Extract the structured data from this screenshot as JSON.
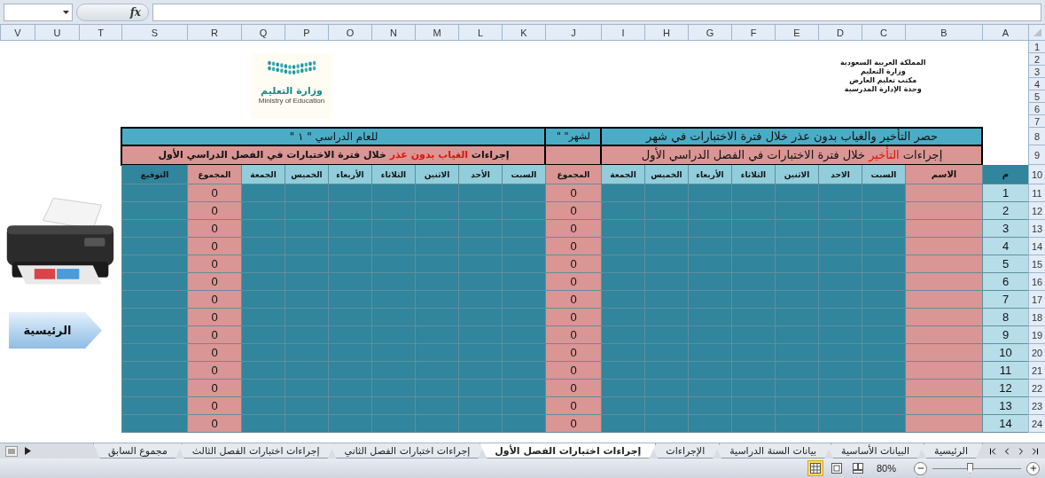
{
  "formula_bar": {
    "function_label": "fx"
  },
  "column_headers": [
    "A",
    "B",
    "C",
    "D",
    "E",
    "F",
    "G",
    "H",
    "I",
    "J",
    "K",
    "L",
    "M",
    "N",
    "O",
    "P",
    "Q",
    "R",
    "S",
    "T",
    "U",
    "V"
  ],
  "row_numbers": [
    "1",
    "2",
    "3",
    "4",
    "5",
    "6",
    "7",
    "8",
    "9",
    "10",
    "11",
    "12",
    "13",
    "14",
    "15",
    "16",
    "17",
    "18",
    "19",
    "20",
    "21",
    "22",
    "23",
    "24"
  ],
  "letterhead": [
    "المملكة العربية السعودية",
    "وزارة التعليم",
    "مكتب تعليم العارض",
    "وحدة الإدارة المدرسية"
  ],
  "logo": {
    "name_ar": "وزارة التعليم",
    "name_en": "Ministry of Education"
  },
  "title_row": {
    "summary": "حصر التأخير والغياب بدون عذر خلال فترة الاختبارات في شهر",
    "month": "لشهر\" \"",
    "year": "للعام الدراسي \" ١ \""
  },
  "section_row": {
    "lateness": [
      {
        "text": "إجراءات ",
        "highlight": false
      },
      {
        "text": "التأخير",
        "highlight": true
      },
      {
        "text": " خلال فترة الاختبارات في الفصل الدراسي الأول",
        "highlight": false
      }
    ],
    "absence": [
      {
        "text": "إجراءات ",
        "highlight": false
      },
      {
        "text": "الغياب بدون عذر",
        "highlight": true
      },
      {
        "text": " خلال فترة الاختبارات في الفصل الدراسي الأول",
        "highlight": false
      }
    ]
  },
  "table_header": {
    "index": "م",
    "name": "الاسم",
    "lateness_days": [
      "السبت",
      "الاحد",
      "الاثنين",
      "الثلاثاء",
      "الأربعاء",
      "الخميس",
      "الجمعة"
    ],
    "lateness_total": "المجموع",
    "absence_days": [
      "السبت",
      "الأحد",
      "الاثنين",
      "الثلاثاء",
      "الأربعاء",
      "الخميس",
      "الجمعة"
    ],
    "absence_total": "المجموع",
    "signature": "التوقيع"
  },
  "students": [
    {
      "index": "1",
      "lateness_total": "0",
      "absence_total": "0"
    },
    {
      "index": "2",
      "lateness_total": "0",
      "absence_total": "0"
    },
    {
      "index": "3",
      "lateness_total": "0",
      "absence_total": "0"
    },
    {
      "index": "4",
      "lateness_total": "0",
      "absence_total": "0"
    },
    {
      "index": "5",
      "lateness_total": "0",
      "absence_total": "0"
    },
    {
      "index": "6",
      "lateness_total": "0",
      "absence_total": "0"
    },
    {
      "index": "7",
      "lateness_total": "0",
      "absence_total": "0"
    },
    {
      "index": "8",
      "lateness_total": "0",
      "absence_total": "0"
    },
    {
      "index": "9",
      "lateness_total": "0",
      "absence_total": "0"
    },
    {
      "index": "10",
      "lateness_total": "0",
      "absence_total": "0"
    },
    {
      "index": "11",
      "lateness_total": "0",
      "absence_total": "0"
    },
    {
      "index": "12",
      "lateness_total": "0",
      "absence_total": "0"
    },
    {
      "index": "13",
      "lateness_total": "0",
      "absence_total": "0"
    },
    {
      "index": "14",
      "lateness_total": "0",
      "absence_total": "0"
    }
  ],
  "home_button": {
    "label": "الرئيسية"
  },
  "sheet_tabs": [
    {
      "label": "الرئيسية",
      "selected": false
    },
    {
      "label": "البيانات الأساسية",
      "selected": false
    },
    {
      "label": "بيانات السنة الدراسية",
      "selected": false
    },
    {
      "label": "الإجراءات",
      "selected": false
    },
    {
      "label": "إجراءات اختبارات الفصل الأول",
      "selected": true
    },
    {
      "label": "إجراءات اختبارات الفصل الثاني",
      "selected": false
    },
    {
      "label": "إجراءات اختبارات الفصل الثالث",
      "selected": false
    },
    {
      "label": "مجموع السابق",
      "selected": false
    }
  ],
  "status_bar": {
    "views": [
      {
        "kind": "normal",
        "selected": true
      },
      {
        "kind": "page_layout",
        "selected": false
      },
      {
        "kind": "page_break",
        "selected": false
      }
    ],
    "zoom": "80%",
    "zoom_slider": {
      "level": 0.42
    }
  }
}
